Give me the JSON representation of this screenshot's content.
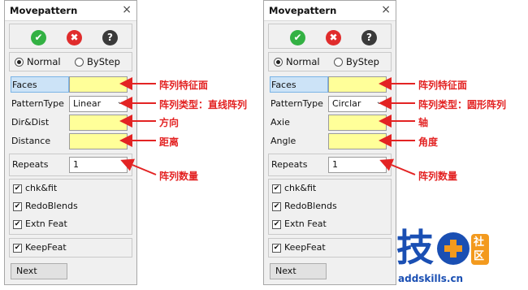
{
  "left_panel": {
    "title": "Movepattern",
    "close": "×",
    "mode": {
      "normal": "Normal",
      "bystep": "ByStep"
    },
    "rows": [
      {
        "label": "Faces",
        "value": "",
        "kind": "yellow"
      },
      {
        "label": "PatternType",
        "value": "Linear",
        "kind": "select"
      },
      {
        "label": "Dir&Dist",
        "value": "",
        "kind": "yellow"
      },
      {
        "label": "Distance",
        "value": "",
        "kind": "yellow"
      }
    ],
    "repeats": {
      "label": "Repeats",
      "value": "1"
    },
    "checks": [
      "chk&fit",
      "RedoBlends",
      "Extn Feat"
    ],
    "keep": "KeepFeat",
    "next": "Next"
  },
  "right_panel": {
    "title": "Movepattern",
    "close": "×",
    "mode": {
      "normal": "Normal",
      "bystep": "ByStep"
    },
    "rows": [
      {
        "label": "Faces",
        "value": "",
        "kind": "yellow"
      },
      {
        "label": "PatternType",
        "value": "Circlar",
        "kind": "select"
      },
      {
        "label": "Axie",
        "value": "",
        "kind": "yellow"
      },
      {
        "label": "Angle",
        "value": "",
        "kind": "yellow"
      }
    ],
    "repeats": {
      "label": "Repeats",
      "value": "1"
    },
    "checks": [
      "chk&fit",
      "RedoBlends",
      "Extn Feat"
    ],
    "keep": "KeepFeat",
    "next": "Next"
  },
  "annotations_left": [
    "阵列特征面",
    "阵列类型：直线阵列",
    "方向",
    "距离",
    "阵列数量"
  ],
  "annotations_right": [
    "阵列特征面",
    "阵列类型：圆形阵列",
    "轴",
    "角度",
    "阵列数量"
  ],
  "logo": {
    "char": "技",
    "badge": "社区",
    "url": "addskills.cn"
  },
  "colors": {
    "accent_red": "#e32323",
    "field_yellow": "#ffff99",
    "ok_green": "#33b143",
    "cancel_red": "#e02c2c",
    "logo_blue": "#1a4fb3",
    "logo_orange": "#f39a1e"
  }
}
